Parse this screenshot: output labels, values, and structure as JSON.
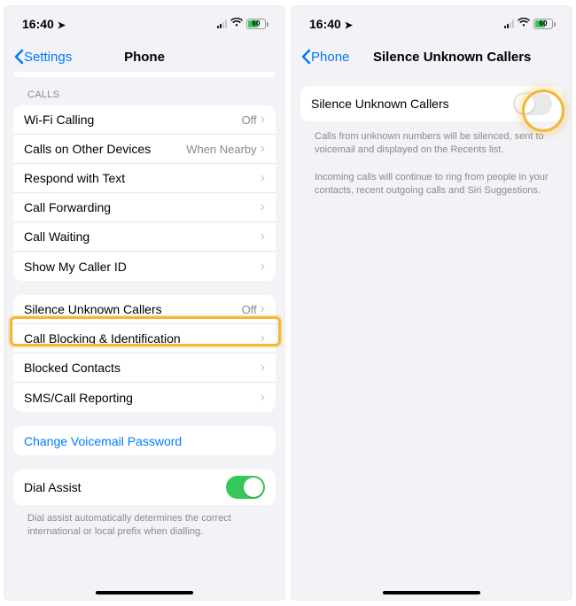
{
  "statusbar": {
    "time": "16:40",
    "battery_pct": "60"
  },
  "screen1": {
    "back_label": "Settings",
    "title": "Phone",
    "calls_header": "CALLS",
    "cells": {
      "wifi_calling": {
        "label": "Wi-Fi Calling",
        "value": "Off"
      },
      "other_devices": {
        "label": "Calls on Other Devices",
        "value": "When Nearby"
      },
      "respond_text": {
        "label": "Respond with Text"
      },
      "call_forwarding": {
        "label": "Call Forwarding"
      },
      "call_waiting": {
        "label": "Call Waiting"
      },
      "caller_id": {
        "label": "Show My Caller ID"
      },
      "silence_unknown": {
        "label": "Silence Unknown Callers",
        "value": "Off"
      },
      "call_blocking": {
        "label": "Call Blocking & Identification"
      },
      "blocked_contacts": {
        "label": "Blocked Contacts"
      },
      "sms_reporting": {
        "label": "SMS/Call Reporting"
      },
      "voicemail_pw": {
        "label": "Change Voicemail Password"
      },
      "dial_assist": {
        "label": "Dial Assist"
      }
    },
    "dial_assist_footer": "Dial assist automatically determines the correct international or local prefix when dialling."
  },
  "screen2": {
    "back_label": "Phone",
    "title": "Silence Unknown Callers",
    "toggle_label": "Silence Unknown Callers",
    "footer1": "Calls from unknown numbers will be silenced, sent to voicemail and displayed on the Recents list.",
    "footer2": "Incoming calls will continue to ring from people in your contacts, recent outgoing calls and Siri Suggestions."
  }
}
